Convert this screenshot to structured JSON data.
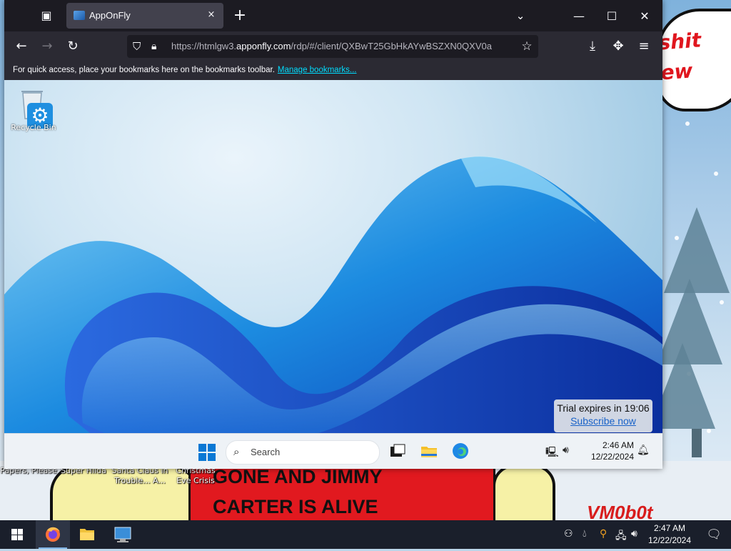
{
  "browser": {
    "tab": {
      "title": "AppOnFly",
      "close_icon": "×"
    },
    "new_tab_icon": "+",
    "url": {
      "prefix": "https://htmlgw3.",
      "host": "apponfly.com",
      "path": "/rdp/#/client/QXBwT25GbHkAYwBSZXN0QXV0a"
    },
    "bookmarks_bar": {
      "text": "For quick access, place your bookmarks here on the bookmarks toolbar.",
      "link": "Manage bookmarks..."
    }
  },
  "remote": {
    "desktop_icon_label": "Recycle Bin",
    "trial": {
      "text": "Trial expires in 19:06",
      "link": "Subscribe now"
    },
    "taskbar": {
      "search_placeholder": "Search",
      "time": "2:46 AM",
      "date": "12/22/2024"
    }
  },
  "host": {
    "speech_text": "shit\new",
    "desktop_icons": [
      {
        "label": "Papers, Please"
      },
      {
        "label": "Super Hilda"
      },
      {
        "label": "Santa Claus in Trouble... A..."
      },
      {
        "label": "Christmas Eve Crisis"
      }
    ],
    "sign_lines": [
      "GONE AND JIMMY",
      "CARTER IS ALIVE"
    ],
    "signature": "VM0b0t",
    "taskbar": {
      "time": "2:47 AM",
      "date": "12/22/2024"
    }
  },
  "colors": {
    "accent": "#0a78d4",
    "firefox_chrome": "#1c1b22",
    "link": "#00ddff",
    "sign_red": "#e1191f"
  }
}
